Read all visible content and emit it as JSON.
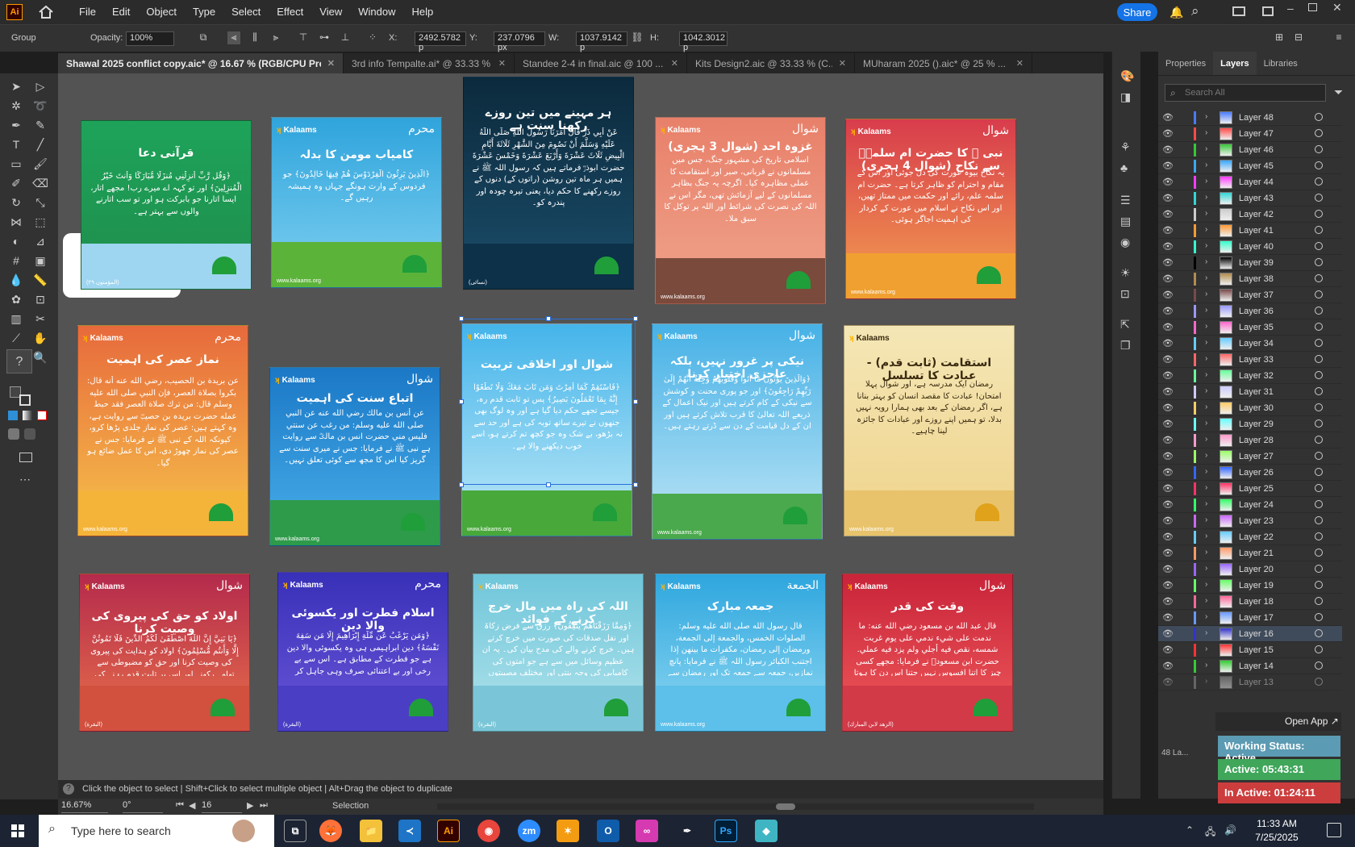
{
  "app": {
    "logo": "Ai"
  },
  "menu": [
    "File",
    "Edit",
    "Object",
    "Type",
    "Select",
    "Effect",
    "View",
    "Window",
    "Help"
  ],
  "share_label": "Share",
  "control": {
    "group_label": "Group",
    "opacity_label": "Opacity:",
    "opacity_value": "100%",
    "x_label": "X:",
    "x_value": "2492.5782 p",
    "y_label": "Y:",
    "y_value": "237.0796 px",
    "w_label": "W:",
    "w_value": "1037.9142 p",
    "h_label": "H:",
    "h_value": "1042.3012 p"
  },
  "tabs": [
    {
      "label": "Shawal 2025 conflict copy.aic* @ 16.67 % (RGB/CPU Preview)",
      "active": true
    },
    {
      "label": "3rd info Tempalte.ai* @ 33.33 % (R...",
      "active": false
    },
    {
      "label": "Standee 2-4 in final.aic @ 100 ...",
      "active": false
    },
    {
      "label": "Kits Design2.aic @ 33.33 % (C...",
      "active": false
    },
    {
      "label": "MUharam 2025 ().aic* @ 25 % ...",
      "active": false
    }
  ],
  "cards": [
    {
      "title": "قرآنی دعا",
      "body": "﴿وَقُل رَّبِّ أَنزِلْنِي مُنزَلًا مُّبَارَكًا وَأَنتَ خَيْرُ الْمُنزِلِينَ﴾ اور تو کہہ اے میرے رب! مجھے اتار، ایسا اتارنا جو بابرکت ہو اور تو سب اتارنے والوں سے بہتر ہے۔",
      "foot": "(المؤمنون ٢٩)"
    },
    {
      "brand": "Kalaams",
      "badge": "محرم",
      "title": "کامیاب مومن کا بدلہ",
      "body": "﴿الَّذِينَ يَرِثُونَ الْفِرْدَوْسَ هُمْ فِيهَا خَالِدُونَ﴾ جو فردوس کے وارث ہونگے جہاں وہ ہمیشہ رہیں گے۔",
      "foot": "www.kalaams.org"
    },
    {
      "title": "ہر مہینے میں تین روزے رکھنا سنت ہے",
      "body": "عَنْ أَبِي ذَرٍّ قَالَ أَمَرَنَا رَسُولُ اللَّهِ صَلَّى اللَّهُ عَلَيْهِ وَسَلَّمَ أَنْ نَصُومَ مِنَ الشَّهْرِ ثَلَاثَةَ أَيَّامِ الْبِيضِ ثَلَاثَ عَشْرَةَ وَأَرْبَعَ عَشْرَةَ وَخَمْسَ عَشْرَةَ حضرت ابوذرؓ فرماتے ہیں کہ رسول اللہ ﷺ نے ہمیں ہر ماہ تین روشن (راتوں کے) دنوں کے روزے رکھنے کا حکم دیا، یعنی تیرہ چودہ اور پندرہ کو۔",
      "foot": "(نسائی)"
    },
    {
      "brand": "Kalaams",
      "badge": "شوال",
      "title": "غزوہ احد (شوال 3 ہجری)",
      "body": "اسلامی تاریخ کی مشہور جنگ، جس میں مسلمانوں نے قربانی، صبر اور استقامت کا عملی مظاہرہ کیا۔ اگرچہ یہ جنگ بظاہر مسلمانوں کے لیے آزمائش تھی، مگر اس نے اللہ کی نصرت کی شرائط اور اللہ پر توکل کا سبق ملا۔",
      "foot": "www.kalaams.org"
    },
    {
      "brand": "Kalaams",
      "badge": "شوال",
      "title": "نبی ﷺ کا حضرت ام سلمہؓ سے نکاح (شوال 4 ہجری)",
      "body": "یہ نکاح بیوہ عورت کی دل جوئی اور اس کے مقام و احترام کو ظاہر کرتا ہے۔ حضرت ام سلمہ علم، رائے اور حکمت میں ممتاز تھیں، اور اس نکاح نے اسلام میں عورت کے کردار کی اہمیت اجاگر ہوئی۔",
      "foot": "www.kalaams.org"
    },
    {
      "brand": "Kalaams",
      "badge": "محرم",
      "title": "نماز عصر کی اہمیت",
      "body": "عن بريدة بن الحصيب، رضي الله عنه أنه قال: بكروا بصلاة العصر، فإن النبي صلى الله عليه وسلم قال: من ترك صلاة العصر فقد حبط عمله حضرت بریدہ بن حصیبؓ سے روایت ہے، وہ کہتے ہیں: عصر کی نماز جلدی پڑھا کرو، کیونکہ اللہ کے نبی ﷺ نے فرمایا: جس نے عصر کی نماز چھوڑ دی، اس کا عمل ضائع ہو گیا۔",
      "foot": "www.kalaams.org"
    },
    {
      "brand": "Kalaams",
      "badge": "شوال",
      "title": "اتباع سنت کی اہمیت",
      "body": "عن أنس بن مالك رضي الله عنه عن النبي صلى الله عليه وسلم: من رغب عن سنتي فليس مني حضرت انس بن مالکؓ سے روایت ہے نبی ﷺ نے فرمایا: جس نے میری سنت سے گریز کیا اس کا مجھ سے کوئی تعلق نہیں۔",
      "foot": "www.kalaams.org"
    },
    {
      "brand": "Kalaams",
      "title": "شوال اور اخلاقی تربیت",
      "body": "﴿فَاسْتَقِمْ كَمَا أُمِرْتَ وَمَن تَابَ مَعَكَ وَلَا تَطْغَوْا إِنَّهُ بِمَا تَعْمَلُونَ بَصِيرٌ﴾ پس تو ثابت قدم رہ، جیسے تجھے حکم دیا گیا ہے اور وہ لوگ بھی جنھوں نے تیرے ساتھ توبہ کی ہے اور حد سے نہ بڑھو، بے شک وہ جو کچھ تم کرتے ہو، اسے خوب دیکھنے والا ہے۔",
      "foot": "www.kalaams.org"
    },
    {
      "brand": "Kalaams",
      "badge": "شوال",
      "title": "نیکی پر غرور نہیں، بلکہ عاجزی اختیار کرنا",
      "body": "﴿وَالَّذِينَ يُؤْتُونَ مَا آتَوا وَّقُلُوبُهُمْ وَجِلَةٌ أَنَّهُمْ إِلَىٰ رَبِّهِمْ رَاجِعُونَ﴾ اور جو پوری محنت و کوشش سے نیکی کے کام کرتے ہیں اور نیک اعمال کے ذریعے اللہ تعالیٰ کا قرب تلاش کرتے ہیں اور ان کے دل قیامت کے دن سے ڈرتے رہتے ہیں۔",
      "foot": "www.kalaams.org"
    },
    {
      "brand": "Kalaams",
      "title": "استقامت (ثابت قدم) - عبادت کا تسلسل",
      "body": "رمضان ایک مدرسہ ہے، اور شوال پہلا امتحان! عبادت کا مقصد انسان کو بہتر بنانا ہے، اگر رمضان کے بعد بھی ہمارا رویہ نہیں بدلا، تو ہمیں اپنے روزے اور عبادات کا جائزہ لینا چاہیے۔",
      "foot": "www.kalaams.org"
    },
    {
      "brand": "Kalaams",
      "badge": "شوال",
      "title": "اولاد کو حق کی پیروی کی وصیت کرنا",
      "body": "﴿يَا بَنِيَّ إِنَّ اللَّهَ اصْطَفَىٰ لَكُمُ الدِّينَ فَلَا تَمُوتُنَّ إِلَّا وَأَنتُم مُّسْلِمُونَ﴾ اولاد کو ہدایت کی پیروی کی وصیت کرنا اور حق کو مضبوطی سے تھامے رکھنے اور اس پر ثابت قدم رہنے کی تاکید کرنا مستحب اور انبیاء کی سنت ہے۔",
      "foot": "(البقرة)"
    },
    {
      "brand": "Kalaams",
      "badge": "محرم",
      "title": "اسلام فطرت اور یکسوئی والا دین",
      "body": "﴿وَمَن يَرْغَبُ عَن مِّلَّةِ إِبْرَاهِيمَ إِلَّا مَن سَفِهَ نَفْسَهُ﴾ دین ابراہیمی ہی وہ یکسوئی والا دین ہے جو فطرت کے مطابق ہے۔ اس سے بے رخی اور بے اعتنائی صرف وہی جاہل کر سکتا ہے جو اپنی فطرت کے مخالف ہو۔",
      "foot": "(البقرة)"
    },
    {
      "brand": "Kalaams",
      "title": "اللہ کی راہ میں مال خرچ کرنے کے فوائد",
      "body": "﴿وَمِمَّا رَزَقْنَاهُمْ يُنفِقُونَ﴾ رزق سے فرض زکاۃ اور نفل صدقات کی صورت میں خرچ کرتے ہیں۔ خرچ کرنے والے کی مدح بیان کی۔ یہ ان عظیم وسائل میں سے ہے جو امتوں کی کامیابی کی وجہ بنتی اور مختلف مصیبتوں سے بچاتی ہیں۔",
      "foot": "(البقرة)"
    },
    {
      "brand": "Kalaams",
      "badge": "الجمعة",
      "title": "جمعہ مبارک",
      "body": "قال رسول الله صلى الله عليه وسلم: الصلوات الخمس، والجمعة إلى الجمعة، ورمضان إلى رمضان، مكفرات ما بينهن إذا اجتنب الكبائر رسول اللہ ﷺ نے فرمایا: پانچ نمازیں، جمعہ سے جمعہ تک اور رمضان سے رمضان تک، درمیان کے گناہوں کا کفارہ بن جاتے ہیں جب کبیرہ گناہوں سے بچا جائے۔",
      "foot": "www.kalaams.org"
    },
    {
      "brand": "Kalaams",
      "badge": "شوال",
      "title": "وقت کی قدر",
      "body": "قال عبد الله بن مسعود رضي الله عنه: ما ندمت على شيء ندمي على يوم غربت شمسه، نقص فيه أجلي ولم يزد فيه عملي. حضرت ابن مسعودؓ نے فرمایا: مجھے کسی چیز کا اتنا افسوس نہیں جتنا اس دن کا ہوتا ہے جس کی شام ہو گئی اور اس میں میرا عمل نہیں بڑھا۔",
      "foot": "(الزهد لابن المبارك)"
    }
  ],
  "panel": {
    "tabs": [
      "Properties",
      "Layers",
      "Libraries"
    ],
    "search_placeholder": "Search All",
    "layers": [
      "Layer 48",
      "Layer 47",
      "Layer 46",
      "Layer 45",
      "Layer 44",
      "Layer 43",
      "Layer 42",
      "Layer 41",
      "Layer 40",
      "Layer 39",
      "Layer 38",
      "Layer 37",
      "Layer 36",
      "Layer 35",
      "Layer 34",
      "Layer 33",
      "Layer 32",
      "Layer 31",
      "Layer 30",
      "Layer 29",
      "Layer 28",
      "Layer 27",
      "Layer 26",
      "Layer 25",
      "Layer 24",
      "Layer 23",
      "Layer 22",
      "Layer 21",
      "Layer 20",
      "Layer 19",
      "Layer 18",
      "Layer 17",
      "Layer 16",
      "Layer 15",
      "Layer 14",
      "Layer 13"
    ],
    "layer_colors": [
      "#4a7bff",
      "#ff4a4a",
      "#37c837",
      "#3aa7ff",
      "#ff3aff",
      "#33d6d6",
      "#cccccc",
      "#ff9933",
      "#33ffcc",
      "#000000",
      "#b28d4f",
      "#7a4a4a",
      "#9999ff",
      "#ff66cc",
      "#66ccff",
      "#ff6666",
      "#66ff99",
      "#ccccff",
      "#ffcc66",
      "#66ffff",
      "#ff99cc",
      "#99ff66",
      "#3366ff",
      "#ff3366",
      "#33ff66",
      "#cc66ff",
      "#66ccff",
      "#ff9966",
      "#9966ff",
      "#66ff66",
      "#ff6699",
      "#6699ff",
      "#3333cc",
      "#ff3333",
      "#33cc33",
      "#999999"
    ],
    "footer": "48 La..."
  },
  "overlay": {
    "open_app": "Open App",
    "working_status": "Working Status: Active",
    "active": "Active: 05:43:31",
    "inactive": "In Active: 01:24:11"
  },
  "status": {
    "hint": "Click the object to select  |  Shift+Click to select multiple object  |  Alt+Drag the object to duplicate",
    "zoom": "16.67%",
    "rotate": "0°",
    "artboard": "16",
    "tool": "Selection"
  },
  "taskbar": {
    "search_placeholder": "Type here to search",
    "time": "11:33 AM",
    "date": "7/25/2025"
  },
  "colors": {
    "accent": "#1473e6",
    "selection": "#2a6fdc"
  }
}
